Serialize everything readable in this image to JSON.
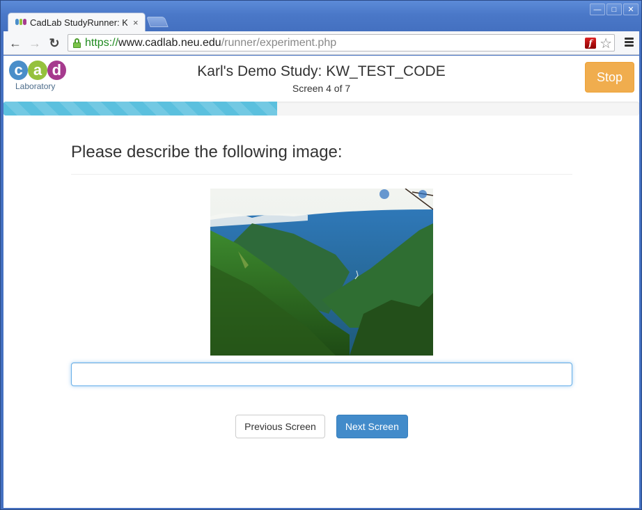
{
  "browser": {
    "tab_title": "CadLab StudyRunner: Karl's Demo Study",
    "tab_close": "×",
    "url": {
      "scheme": "https://",
      "host": "www.cadlab.neu.edu",
      "path": "/runner/experiment.php"
    },
    "icons": {
      "back": "←",
      "forward": "→",
      "reload": "↻",
      "bookmark": "☆",
      "flash": "f",
      "minimize": "—",
      "maximize": "□",
      "close": "✕"
    }
  },
  "header": {
    "logo": {
      "letters": [
        "c",
        "a",
        "d"
      ],
      "colors": [
        "#4a8ec9",
        "#95c13d",
        "#a63a8e"
      ],
      "subtitle": "Laboratory"
    },
    "study_title": "Karl's Demo Study: KW_TEST_CODE",
    "screen_count": "Screen 4 of 7",
    "stop_label": "Stop"
  },
  "progress": {
    "percent": 43,
    "color": "#5bc0de"
  },
  "main": {
    "prompt": "Please describe the following image:",
    "image_alt": "Green mountain valley landscape with clouds",
    "answer_value": "",
    "answer_placeholder": "",
    "previous_label": "Previous Screen",
    "next_label": "Next Screen"
  },
  "colors": {
    "stop": "#f0ad4e",
    "primary": "#428bca",
    "focus": "#66afe9"
  }
}
